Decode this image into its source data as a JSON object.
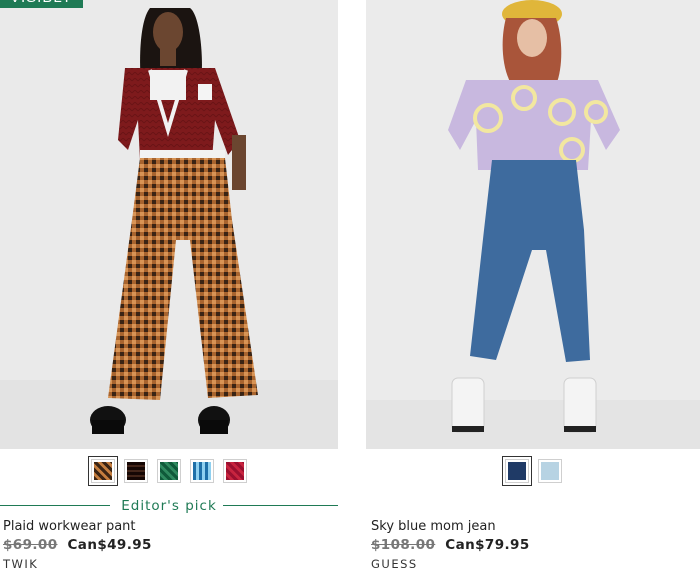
{
  "products": [
    {
      "badge": "VISIBLY",
      "editor_pick": "Editor's pick",
      "name": "Plaid workwear pant",
      "old_price": "$69.00",
      "new_price": "Can$49.95",
      "brand": "TWIK",
      "swatches": [
        "brown-plaid",
        "brown-tartan",
        "green-tartan",
        "blue-tartan",
        "red-tartan"
      ],
      "selected_swatch": "brown-plaid"
    },
    {
      "name": "Sky blue mom jean",
      "old_price": "$108.00",
      "new_price": "Can$79.95",
      "brand": "GUESS",
      "swatches": [
        "navy-denim",
        "light-blue-denim"
      ],
      "selected_swatch": "navy-denim"
    }
  ],
  "colors": {
    "accent_green": "#1f7a55",
    "photo_background": "#ececec"
  }
}
